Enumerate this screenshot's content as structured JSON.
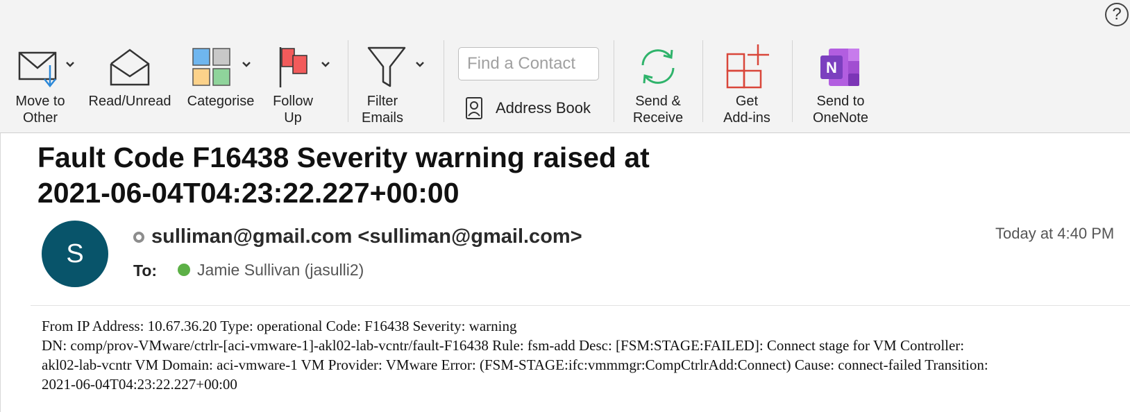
{
  "ribbon": {
    "move_to_other": "Move to\nOther",
    "read_unread": "Read/Unread",
    "categorise": "Categorise",
    "follow_up": "Follow\nUp",
    "filter_emails": "Filter\nEmails",
    "find_contact_placeholder": "Find a Contact",
    "address_book": "Address Book",
    "send_receive": "Send &\nReceive",
    "get_addins": "Get\nAdd-ins",
    "send_onenote": "Send to\nOneNote",
    "help": "?"
  },
  "message": {
    "subject": "Fault Code F16438 Severity warning raised at\n2021-06-04T04:23:22.227+00:00",
    "avatar_initial": "S",
    "sender": "sulliman@gmail.com <sulliman@gmail.com>",
    "date": "Today at 4:40 PM",
    "to_label": "To:",
    "recipient": "Jamie Sullivan (jasulli2)",
    "body_lines": [
      "From IP  Address: 10.67.36.20 Type: operational Code: F16438 Severity: warning",
      "DN: comp/prov-VMware/ctrlr-[aci-vmware-1]-akl02-lab-vcntr/fault-F16438 Rule: fsm-add Desc: [FSM:STAGE:FAILED]: Connect stage for VM Controller:",
      "akl02-lab-vcntr VM Domain: aci-vmware-1 VM Provider: VMware Error: (FSM-STAGE:ifc:vmmmgr:CompCtrlrAdd:Connect) Cause: connect-failed Transition:",
      "2021-06-04T04:23:22.227+00:00"
    ]
  },
  "colors": {
    "avatar": "#08546a",
    "presence_available": "#5cb046",
    "onenote": "#7b3fbf",
    "send_receive": "#2fb36b",
    "addins": "#d9463a"
  }
}
